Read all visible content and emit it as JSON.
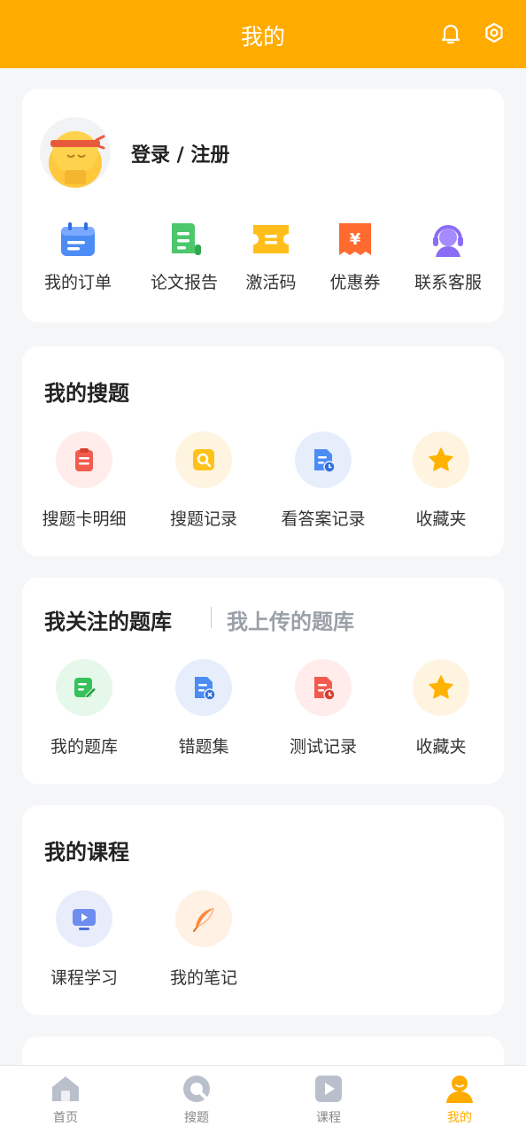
{
  "header": {
    "title": "我的"
  },
  "profile": {
    "login_label": "登录 / 注册"
  },
  "quick_actions": [
    {
      "label": "我的订单",
      "icon": "calendar-icon"
    },
    {
      "label": "论文报告",
      "icon": "scroll-icon"
    },
    {
      "label": "激活码",
      "icon": "ticket-icon"
    },
    {
      "label": "优惠券",
      "icon": "coupon-icon"
    },
    {
      "label": "联系客服",
      "icon": "headset-icon"
    }
  ],
  "my_search": {
    "title": "我的搜题",
    "items": [
      {
        "label": "搜题卡明细",
        "icon": "clipboard-icon"
      },
      {
        "label": "搜题记录",
        "icon": "search-icon"
      },
      {
        "label": "看答案记录",
        "icon": "document-clock-icon"
      },
      {
        "label": "收藏夹",
        "icon": "star-icon"
      }
    ]
  },
  "question_bank": {
    "tab_active": "我关注的题库",
    "tab_inactive": "我上传的题库",
    "items": [
      {
        "label": "我的题库",
        "icon": "edit-doc-icon"
      },
      {
        "label": "错题集",
        "icon": "doc-x-icon"
      },
      {
        "label": "测试记录",
        "icon": "doc-clock-icon"
      },
      {
        "label": "收藏夹",
        "icon": "star-icon"
      }
    ]
  },
  "my_courses": {
    "title": "我的课程",
    "items": [
      {
        "label": "课程学习",
        "icon": "monitor-play-icon"
      },
      {
        "label": "我的笔记",
        "icon": "feather-icon"
      }
    ]
  },
  "tabbar": [
    {
      "label": "首页",
      "icon": "home-icon"
    },
    {
      "label": "搜题",
      "icon": "search-tab-icon"
    },
    {
      "label": "课程",
      "icon": "play-tab-icon"
    },
    {
      "label": "我的",
      "icon": "user-icon"
    }
  ],
  "colors": {
    "brand": "#ffab00",
    "background": "#f5f6f8"
  }
}
